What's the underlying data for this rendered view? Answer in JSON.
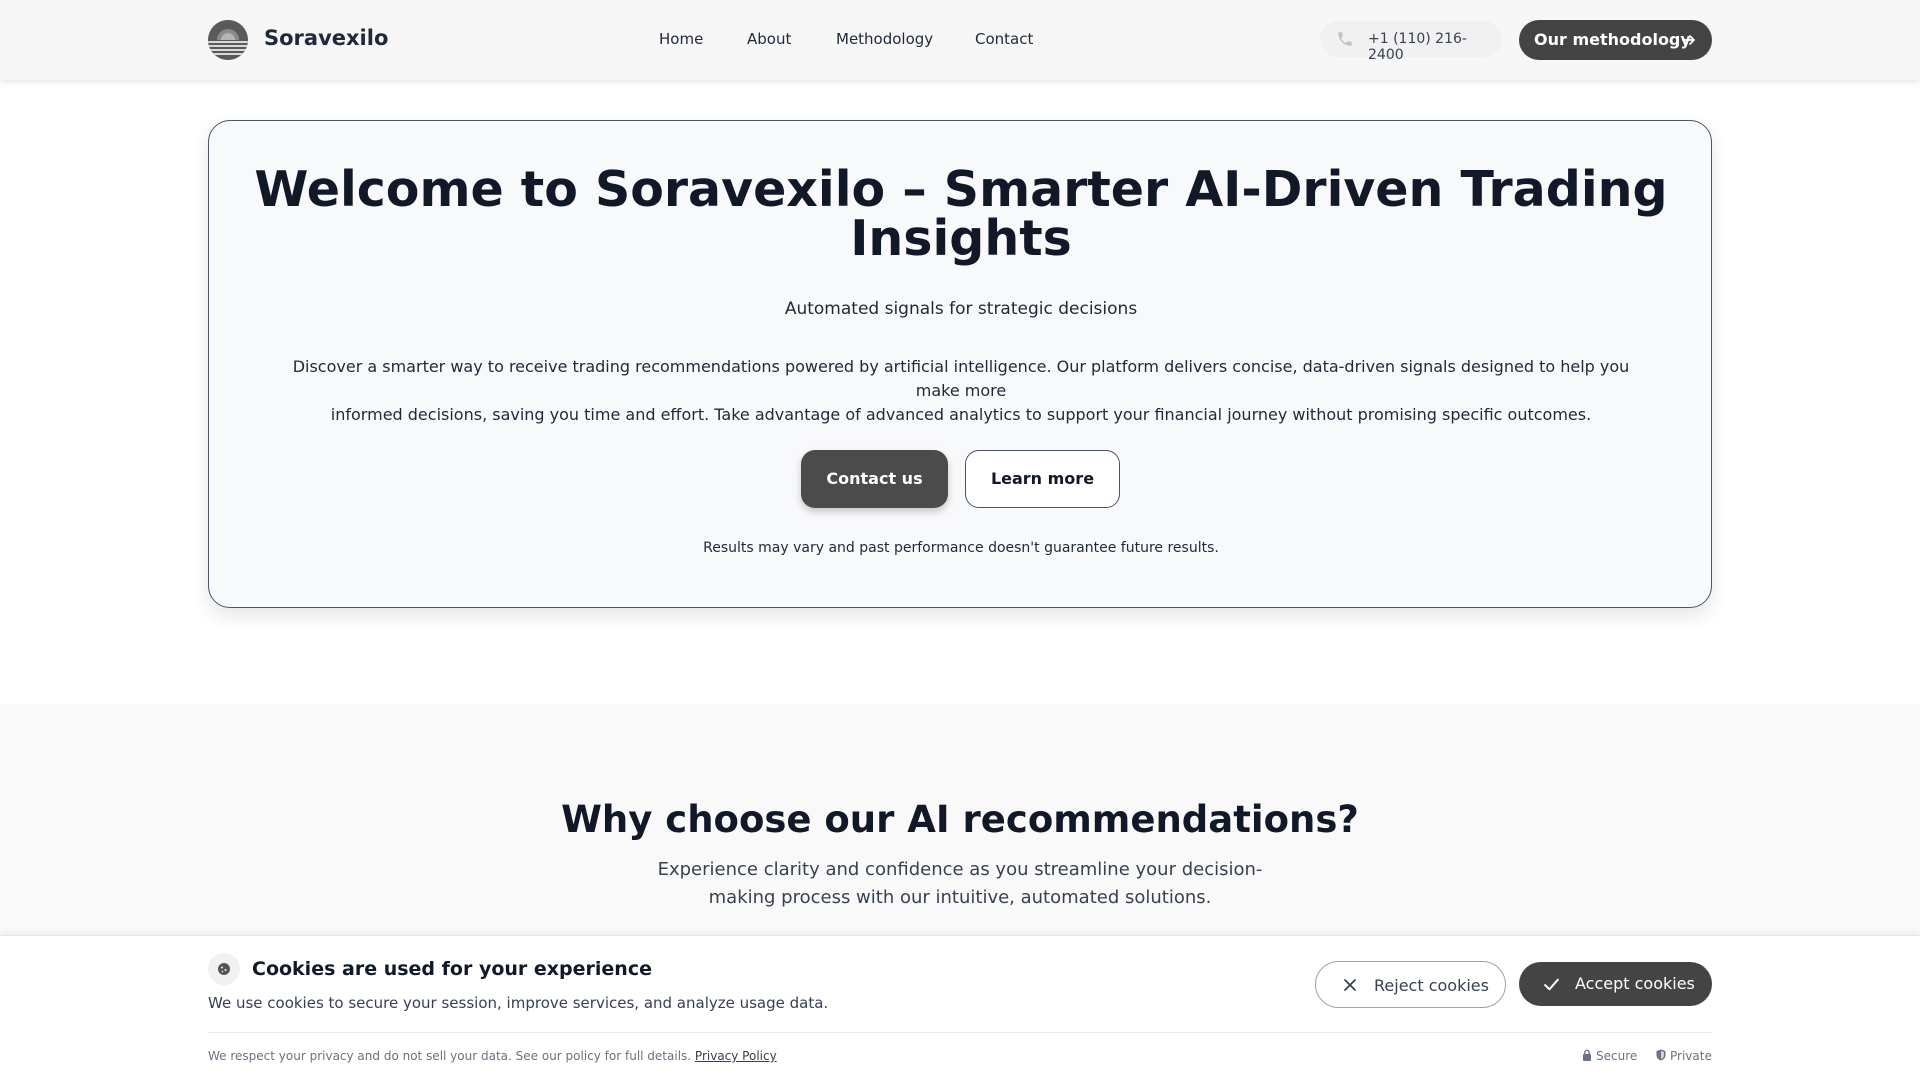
{
  "header": {
    "brand": "Soravexilo",
    "nav": [
      "Home",
      "About",
      "Methodology",
      "Contact"
    ],
    "phone": "+1 (110) 216-2400",
    "cta_label": "Our methodology",
    "icons": {
      "logo": "sunset-logo-icon",
      "phone": "phone-icon",
      "cta": "arrow-right-icon"
    }
  },
  "hero": {
    "title_line1": "Welcome to Soravexilo – Smarter AI-Driven Trading",
    "title_line2": "Insights",
    "subtitle": "Automated signals for strategic decisions",
    "description_line1": "Discover a smarter way to receive trading recommendations powered by artificial intelligence. Our platform delivers concise, data-driven signals designed to help you make more",
    "description_line2": "informed decisions, saving you time and effort. Take advantage of advanced analytics to support your financial journey without promising specific outcomes.",
    "contact_label": "Contact us",
    "learn_label": "Learn more",
    "note": "Results may vary and past performance doesn't guarantee future results."
  },
  "why": {
    "title": "Why choose our AI recommendations?",
    "subtitle": "Experience clarity and confidence as you streamline your decision-making process with our intuitive, automated solutions."
  },
  "cookie": {
    "title": "Cookies are used for your experience",
    "text": "We use cookies to secure your session, improve services, and analyze usage data.",
    "reject_label": "Reject cookies",
    "accept_label": "Accept cookies",
    "privacy_text": "We respect your privacy and do not sell your data. See our policy for full details.",
    "privacy_link": "Privacy Policy",
    "badge_secure": "Secure",
    "badge_private": "Private",
    "icons": {
      "cookie": "cookie-icon",
      "reject": "close-icon",
      "accept": "check-icon",
      "secure": "lock-icon",
      "private": "shield-icon"
    }
  },
  "colors": {
    "dark_button": "#444444",
    "title": "#111827",
    "card_bg": "#f8f9fb",
    "section_bg": "#f9f9f9"
  }
}
